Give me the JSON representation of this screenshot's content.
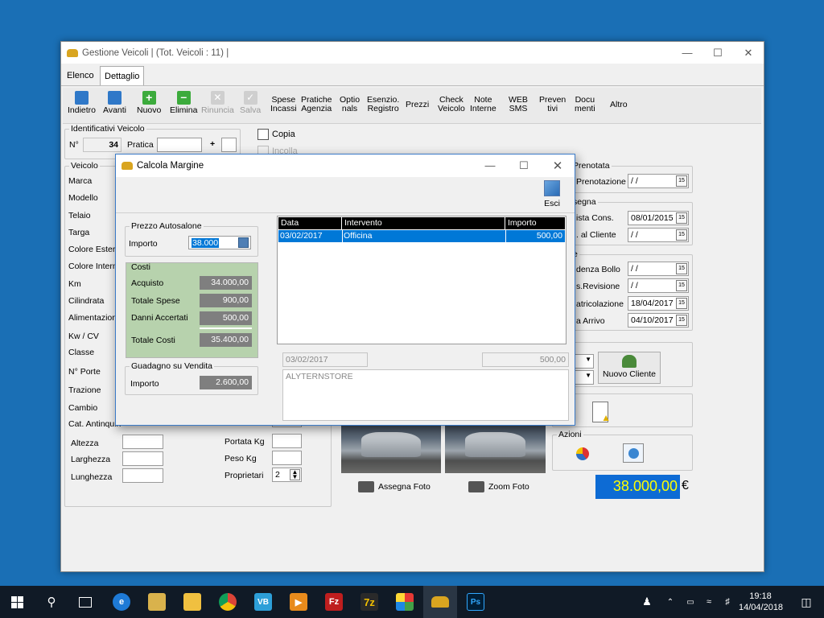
{
  "main_window": {
    "title": "Gestione Veicoli | (Tot. Veicoli : 11) |",
    "tabs": [
      "Elenco",
      "Dettaglio"
    ],
    "toolbar_icon_buttons": [
      {
        "label": "Indietro",
        "icon": "arrow-left-icon",
        "enabled": true
      },
      {
        "label": "Avanti",
        "icon": "arrow-right-icon",
        "enabled": true
      },
      {
        "label": "Nuovo",
        "icon": "plus-icon",
        "enabled": true
      },
      {
        "label": "Elimina",
        "icon": "minus-icon",
        "enabled": true
      },
      {
        "label": "Rinuncia",
        "icon": "cancel-icon",
        "enabled": false
      },
      {
        "label": "Salva",
        "icon": "check-icon",
        "enabled": false
      }
    ],
    "toolbar_text_buttons": [
      {
        "l1": "Spese",
        "l2": "Incassi"
      },
      {
        "l1": "Pratiche",
        "l2": "Agenzia"
      },
      {
        "l1": "Optio",
        "l2": "nals"
      },
      {
        "l1": "Esenzio.",
        "l2": "Registro"
      },
      {
        "l1": "Prezzi",
        "l2": ""
      },
      {
        "l1": "Check",
        "l2": "Veicolo"
      },
      {
        "l1": "Note",
        "l2": "Interne"
      },
      {
        "l1": "WEB",
        "l2": "SMS"
      },
      {
        "l1": "Preven",
        "l2": "tivi"
      },
      {
        "l1": "Docu",
        "l2": "menti"
      },
      {
        "l1": "Altro",
        "l2": ""
      }
    ],
    "identificativi": {
      "title": "Identificativi Veicolo",
      "n_label": "N°",
      "n_value": "34",
      "pratica_label": "Pratica",
      "pratica_value": "",
      "plus": "+"
    },
    "copia_label": "Copia",
    "incolla_label": "Incolla",
    "veicolo": {
      "title": "Veicolo",
      "labels": [
        "Marca",
        "Modello",
        "Telaio",
        "Targa",
        "Colore Estern",
        "Colore Intern",
        "Km",
        "Cilindrata",
        "Alimentazione",
        "Kw / CV",
        "Classe",
        "N° Porte",
        "Trazione",
        "Cambio",
        "Cat. Antinquin"
      ],
      "altezza": "Altezza",
      "larghezza": "Larghezza",
      "lunghezza": "Lunghezza",
      "portata": "Portata Kg",
      "peso": "Peso Kg",
      "proprietari": "Proprietari",
      "proprietari_value": "2"
    },
    "right_dates": {
      "prenotata_title": "Prenotata",
      "prenotazione_label": "Prenotazione",
      "prenotazione_value": "/ /",
      "consegna_title": "segna",
      "vista_cons_label": "ista Cons.",
      "vista_cons_value": "08/01/2015",
      "al_cliente_label": ". al Cliente",
      "al_cliente_value": "/ /",
      "scadenze_title": "e",
      "bollo_label": "denza Bollo",
      "bollo_value": "/ /",
      "revisione_label": "s.Revisione",
      "revisione_value": "/ /",
      "immatricolazione_label": "atricolazione",
      "immatricolazione_value": "18/04/2017",
      "arrivo_label": "a Arrivo",
      "arrivo_value": "04/10/2017"
    },
    "nuovo_cliente_label": "Nuovo Cliente",
    "azioni_title": "Azioni",
    "assegna_foto_label": "Assegna Foto",
    "zoom_foto_label": "Zoom Foto",
    "price_value": "38.000,00",
    "currency": "€"
  },
  "dialog": {
    "title": "Calcola Margine",
    "esci_label": "Esci",
    "prezzo": {
      "title": "Prezzo Autosalone",
      "importo_label": "Importo",
      "importo_value": "38.000"
    },
    "costi": {
      "title": "Costi",
      "rows": [
        {
          "label": "Acquisto",
          "value": "34.000,00"
        },
        {
          "label": "Totale Spese",
          "value": "900,00"
        },
        {
          "label": "Danni Accertati",
          "value": "500,00"
        }
      ],
      "totale_label": "Totale Costi",
      "totale_value": "35.400,00"
    },
    "guadagno": {
      "title": "Guadagno su Vendita",
      "importo_label": "Importo",
      "importo_value": "2.600,00"
    },
    "grid": {
      "headers": [
        "Data",
        "Intervento",
        "Importo"
      ],
      "rows": [
        {
          "data": "03/02/2017",
          "intervento": "Officina",
          "importo": "500,00"
        }
      ]
    },
    "detail_date": "03/02/2017",
    "detail_amount": "500,00",
    "detail_note": "ALYTERNSTORE"
  },
  "taskbar": {
    "time": "19:18",
    "date": "14/04/2018",
    "apps": [
      "start-icon",
      "search-icon",
      "task-view-icon",
      "edge-icon",
      "explorer-icon",
      "folder-icon",
      "chrome-icon",
      "vb-icon",
      "media-icon",
      "filezilla-icon",
      "sevenzip-icon",
      "app-icon",
      "car-app-icon",
      "photoshop-icon"
    ]
  },
  "colors": {
    "desktop": "#1a6fb5",
    "accent_blue": "#0078d7",
    "price_bg": "#0d6bd4",
    "price_text": "#ffff00",
    "costi_bg": "#b7d2ad"
  }
}
